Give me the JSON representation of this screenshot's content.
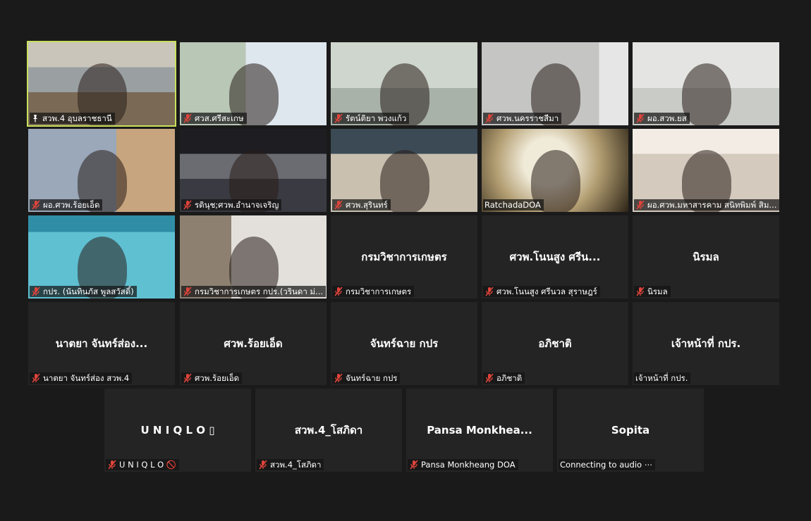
{
  "tiles": [
    {
      "name": "สวพ.4 อุบลราชธานี",
      "pinned": true,
      "muted": false,
      "center": ""
    },
    {
      "name": "ศวส.ศรีสะเกษ",
      "pinned": false,
      "muted": true,
      "center": ""
    },
    {
      "name": "รัตน์ติยา พวงแก้ว",
      "pinned": false,
      "muted": true,
      "center": ""
    },
    {
      "name": "ศวพ.นครราชสีมา",
      "pinned": false,
      "muted": true,
      "center": ""
    },
    {
      "name": "ผอ.สวพ.ยส",
      "pinned": false,
      "muted": true,
      "center": ""
    },
    {
      "name": "ผอ.ศวพ.ร้อยเอ็ด",
      "pinned": false,
      "muted": true,
      "center": ""
    },
    {
      "name": "รตินุช;ศวพ.อำนาจเจริญ",
      "pinned": false,
      "muted": true,
      "center": ""
    },
    {
      "name": "ศวพ.สุรินทร์",
      "pinned": false,
      "muted": true,
      "center": ""
    },
    {
      "name": "RatchadaDOA",
      "pinned": false,
      "muted": false,
      "center": ""
    },
    {
      "name": "ผอ.ศวพ.มหาสารคาม สนิทพิมพ์ สิม...",
      "pinned": false,
      "muted": true,
      "center": ""
    },
    {
      "name": "กปร. (นันทินภัส พูลสวัสดิ์)",
      "pinned": false,
      "muted": true,
      "center": ""
    },
    {
      "name": "กรมวิชาการเกษตร กปร.(วรินดา ม่...",
      "pinned": false,
      "muted": true,
      "center": ""
    },
    {
      "name": "กรมวิชาการเกษตร",
      "pinned": false,
      "muted": true,
      "center": "กรมวิชาการเกษตร"
    },
    {
      "name": "ศวพ.โนนสูง ศรีนวล สุราษฎร์",
      "pinned": false,
      "muted": true,
      "center": "ศวพ.โนนสูง ศรีน..."
    },
    {
      "name": "นิรมล",
      "pinned": false,
      "muted": true,
      "center": "นิรมล"
    },
    {
      "name": "นาตยา จันทร์ส่อง สวพ.4",
      "pinned": false,
      "muted": true,
      "center": "นาตยา จันทร์ส่อง..."
    },
    {
      "name": "ศวพ.ร้อยเอ็ด",
      "pinned": false,
      "muted": true,
      "center": "ศวพ.ร้อยเอ็ด"
    },
    {
      "name": "จันทร์ฉาย  กปร",
      "pinned": false,
      "muted": true,
      "center": "จันทร์ฉาย  กปร"
    },
    {
      "name": "อภิชาติ",
      "pinned": false,
      "muted": true,
      "center": "อภิชาติ"
    },
    {
      "name": "เจ้าหน้าที่ กปร.",
      "pinned": false,
      "muted": false,
      "center": "เจ้าหน้าที่ กปร."
    },
    {
      "name": "U N I Q L O 🚫",
      "pinned": false,
      "muted": true,
      "center": "U N I Q L O ▯"
    },
    {
      "name": "สวพ.4_โสภิดา",
      "pinned": false,
      "muted": true,
      "center": "สวพ.4_โสภิดา"
    },
    {
      "name": "Pansa Monkheang DOA",
      "pinned": false,
      "muted": true,
      "center": "Pansa  Monkhea..."
    },
    {
      "name": "Connecting to audio ⋯",
      "pinned": false,
      "muted": false,
      "center": "Sopita"
    }
  ],
  "colors": {
    "active_border": "#c9e05b",
    "mute_icon": "#e0443b",
    "background": "#1a1a1a",
    "tile": "#242424"
  }
}
